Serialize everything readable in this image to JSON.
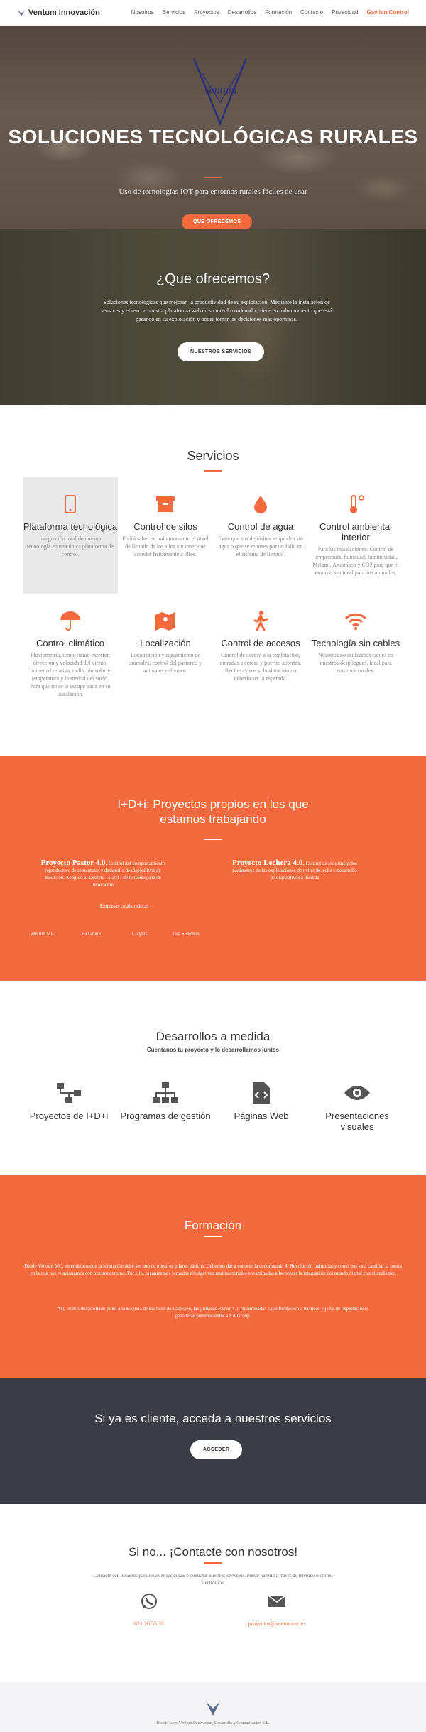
{
  "nav": {
    "brand": "Ventum Innovación",
    "items": [
      "Nosotros",
      "Servicios",
      "Proyectos",
      "Desarrollos",
      "Formación",
      "Contacto",
      "Privacidad"
    ],
    "highlight": "Gavilan Control"
  },
  "hero": {
    "title": "SOLUCIONES TECNOLÓGICAS RURALES",
    "subtitle": "Uso de tecnologías IOT para entornos rurales fáciles de usar",
    "cta": "QUE OFRECEMOS",
    "logo_text": "Ventum"
  },
  "offer": {
    "title": "¿Que ofrecemos?",
    "text": "Soluciones tecnológicas que mejoran la productividad de su explotación. Mediante la instalación de sensores y el uso de nuestra plataforma web en su móvil u ordenador, tiene en todo momento que está pasando en su explotación y poder tomar las decisiones más oportunas.",
    "cta": "NUESTROS SERVICIOS"
  },
  "services": {
    "title": "Servicios",
    "items": [
      {
        "icon": "mobile-icon",
        "title": "Plataforma tecnológica",
        "text": "Integración total de nuestra tecnología en una única plataforma de control."
      },
      {
        "icon": "box-icon",
        "title": "Control de silos",
        "text": "Podrá saber en todo momento el nivel de llenado de los silos sin tener que acceder físicamente a ellos."
      },
      {
        "icon": "drop-icon",
        "title": "Control de agua",
        "text": "Evite que sus depósitos se queden sin agua o que se reboses por un fallo en el sistema de llenado."
      },
      {
        "icon": "thermometer-icon",
        "title": "Control ambiental interior",
        "text": "Para las instalaciones: Control de temperatura, humedad, luminosidad, Metano, Amoníaco y CO2 para que el entorno sea ideal para sus animales."
      },
      {
        "icon": "umbrella-icon",
        "title": "Control climático",
        "text": "Pluviometría, temperatura exterior, dirección y velocidad del viento, humedad relativa, radiación solar y temperatura y humedad del suelo. Para que no se le escape nada en su instalación."
      },
      {
        "icon": "map-icon",
        "title": "Localización",
        "text": "Localización y seguimiento de animales, control del pastoreo y animales enfermos."
      },
      {
        "icon": "walking-icon",
        "title": "Control de accesos",
        "text": "Control de acceso a la explotación, entradas a cercas y puertas abiertas. Recibe avisos si la situación no debería ser la esperada."
      },
      {
        "icon": "wifi-icon",
        "title": "Tecnología sin cables",
        "text": "Nosotros no utilizamos cables en nuestros despliegues, ideal para entornos rurales."
      }
    ]
  },
  "idi": {
    "title": "I+D+i: Proyectos propios en los que estamos trabajando",
    "projects": [
      {
        "name": "Proyecto Pastor 4.0.",
        "text": "Control del comportamiento reproductivo de sementales y desarrollo de dispositivos de medición. Acogido al Decreto 11/2017 de la Consejería de Innovación."
      },
      {
        "name": "Proyecto Lechera 4.0.",
        "text": "Control de los principales parámetros de las explotaciones de ovino de leche y desarrollo de dispositivos a medida"
      }
    ],
    "collab_title": "Empresas colaboradoras",
    "collaborators": [
      "Ventum MC",
      "Ea Group",
      "Cicytex",
      "TnT Sistemas"
    ]
  },
  "desarrollos": {
    "title": "Desarrollos a medida",
    "subtitle": "Cuentanos tu proyecto y lo desarrollamos juntos",
    "items": [
      {
        "icon": "sitemap-icon",
        "title": "Proyectos de I+D+i"
      },
      {
        "icon": "network-icon",
        "title": "Programas de gestión"
      },
      {
        "icon": "code-file-icon",
        "title": "Páginas Web"
      },
      {
        "icon": "eye-icon",
        "title": "Presentaciones visuales"
      }
    ]
  },
  "formacion": {
    "title": "Formación",
    "p1": "Desde Ventum MC, entendemos que la formación debe ser uno de nuestros pilares básicos. Debemos dar a conocer la denominada 4ª Revolución Industrial y como nos va a cambiar la forma en la que nos relacionamos con nuestro entorno. Por ello, organizamos jornadas divulgativas multisectoriales encaminadas a favorecer la integración del mundo digital con el analógico",
    "p2": "Así, hemos desarrollado junto a la Escuela de Pastores de Casteavo, las jornadas Pastor 4.0, encaminadas a dar formación a técnicos y jefes de explotaciones ganaderas pertenecientes a EA Group."
  },
  "client": {
    "title": "Si ya es cliente, acceda a nuestros servicios",
    "cta": "ACCEDER"
  },
  "contact": {
    "title": "Si no... ¡Contacte con nosotros!",
    "text": "Contacte con nosotros para resolver sus dudas o contratar nuestros servicios. Puede hacerlo a través de teléfono o correo electrónico.",
    "phone": "621 20 55 31",
    "email": "proyectos@ventummc.es"
  },
  "footer": {
    "text": "Diseño web: Ventum Innovación, Desarrollo y Comunicación S.L."
  },
  "colors": {
    "accent": "#f26a3d",
    "dark": "#3a3d46"
  }
}
